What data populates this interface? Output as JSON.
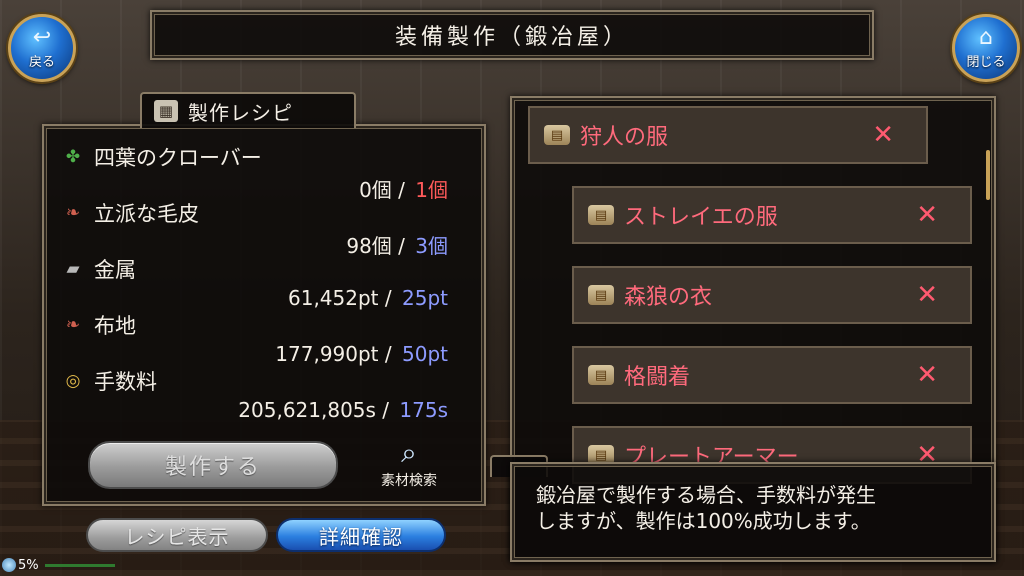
{
  "header": {
    "title": "装備製作（鍛冶屋）",
    "back_label": "戻る",
    "close_label": "閉じる"
  },
  "recipe_panel": {
    "title": "製作レシピ",
    "materials": [
      {
        "name": "四葉のクローバー",
        "icon": "clover-icon",
        "have": "0個",
        "sep": "/",
        "need": "1個",
        "need_color": "#ff5a5a"
      },
      {
        "name": "立派な毛皮",
        "icon": "fur-icon",
        "have": "98個",
        "sep": "/",
        "need": "3個",
        "need_color": "#8d9bff"
      },
      {
        "name": "金属",
        "icon": "metal-ingot-icon",
        "have": "61,452pt",
        "sep": "/",
        "need": "25pt",
        "need_color": "#8d9bff"
      },
      {
        "name": "布地",
        "icon": "cloth-icon",
        "have": "177,990pt",
        "sep": "/",
        "need": "50pt",
        "need_color": "#8d9bff"
      },
      {
        "name": "手数料",
        "icon": "coins-icon",
        "have": "205,621,805s",
        "sep": "/",
        "need": "175s",
        "need_color": "#8d9bff"
      }
    ],
    "craft_label": "製作する",
    "search_label": "素材検索"
  },
  "bottom_buttons": {
    "recipe_label": "レシピ表示",
    "detail_label": "詳細確認"
  },
  "status": {
    "percent": "5%"
  },
  "recipe_list": {
    "items": [
      {
        "name": "狩人の服",
        "mark": "✕"
      },
      {
        "name": "ストレイエの服",
        "mark": "✕"
      },
      {
        "name": "森狼の衣",
        "mark": "✕"
      },
      {
        "name": "格闘着",
        "mark": "✕"
      },
      {
        "name": "プレートアーマー",
        "mark": "✕"
      }
    ]
  },
  "info": {
    "line1": "鍛冶屋で製作する場合、手数料が発生",
    "line2": "しますが、製作は100%成功します。"
  }
}
